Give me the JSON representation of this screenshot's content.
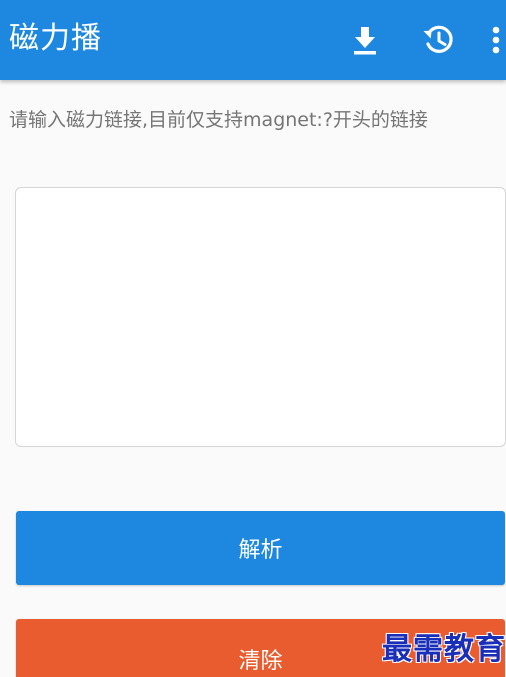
{
  "appbar": {
    "title": "磁力播",
    "background": "#1e88e0",
    "actions": [
      {
        "icon": "download-icon"
      },
      {
        "icon": "history-icon"
      },
      {
        "icon": "more-vert-icon"
      }
    ]
  },
  "hint": "请输入磁力链接,目前仅支持magnet:?开头的链接",
  "input": {
    "value": "",
    "placeholder": ""
  },
  "buttons": {
    "parse_label": "解析",
    "parse_color": "#1e88e0",
    "clear_label": "清除",
    "clear_color": "#e95c2f"
  },
  "watermark": "最需教育"
}
